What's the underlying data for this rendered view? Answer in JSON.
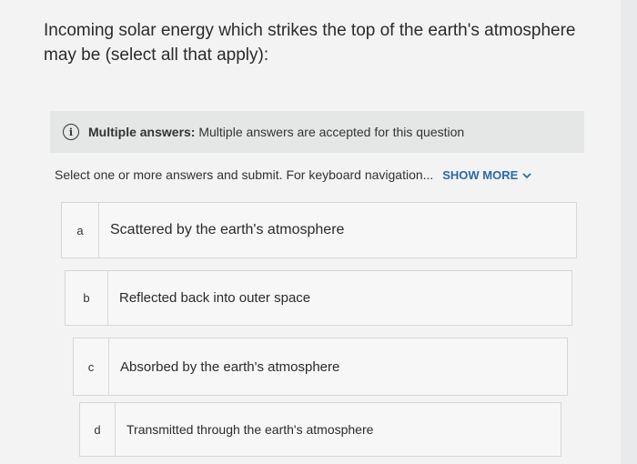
{
  "question": {
    "text": "Incoming solar energy which strikes the top of the earth's atmosphere may be (select all that apply):"
  },
  "info": {
    "icon": "info-icon",
    "icon_glyph": "i",
    "label": "Multiple answers:",
    "message": " Multiple answers are accepted for this question"
  },
  "instructions": {
    "text": "Select one or more answers and submit. For keyboard navigation...",
    "show_more": "SHOW MORE",
    "chevron": "chevron-down-icon"
  },
  "options": [
    {
      "letter": "a",
      "text": "Scattered by the earth's atmosphere"
    },
    {
      "letter": "b",
      "text": "Reflected back into outer space"
    },
    {
      "letter": "c",
      "text": "Absorbed by the earth's atmosphere"
    },
    {
      "letter": "d",
      "text": "Transmitted through the earth's atmosphere"
    }
  ],
  "colors": {
    "link": "#2b6aa8",
    "banner": "#e4e7e6",
    "background": "#f3f3f4"
  }
}
